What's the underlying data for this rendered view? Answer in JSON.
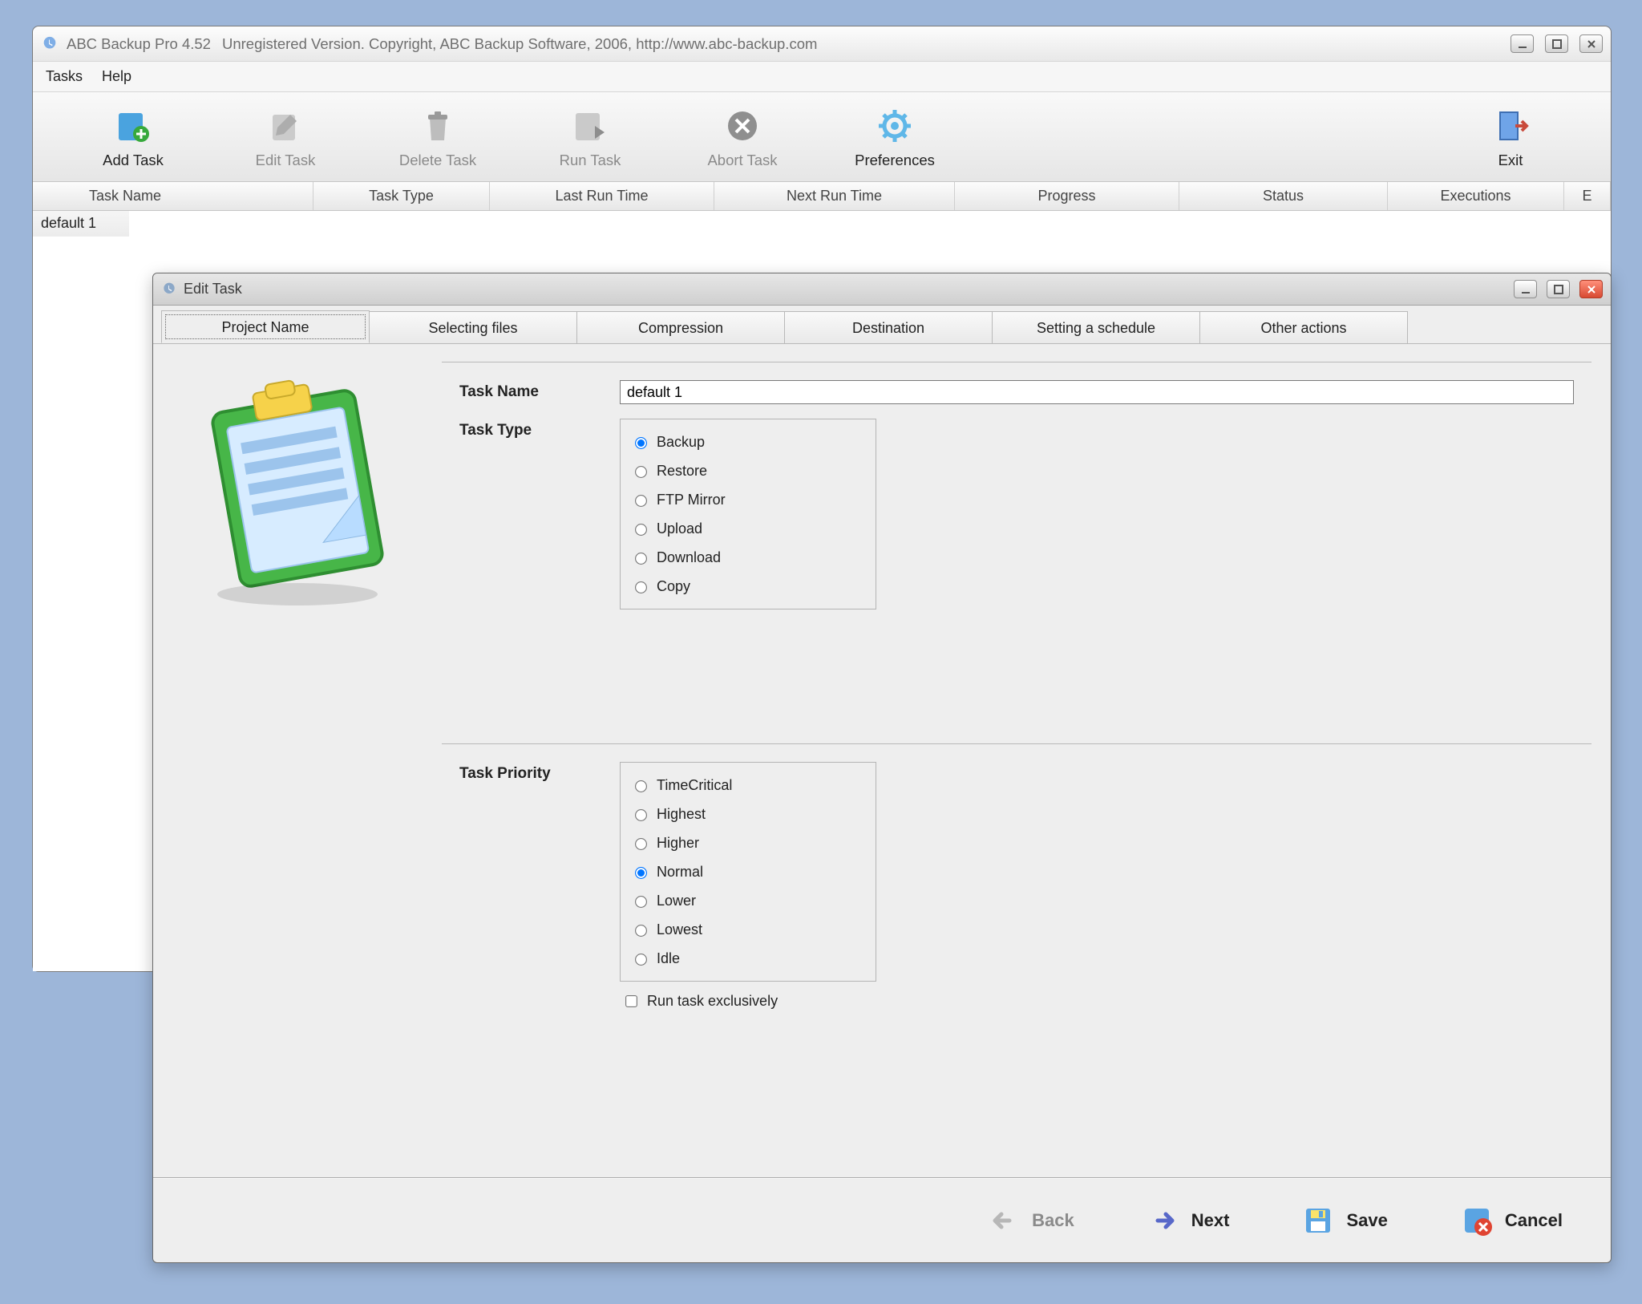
{
  "main_window": {
    "title": "ABC Backup Pro 4.52",
    "subtitle": "Unregistered Version. Copyright, ABC Backup Software, 2006, http://www.abc-backup.com",
    "menubar": {
      "tasks": "Tasks",
      "help": "Help"
    },
    "toolbar": {
      "add_task": "Add Task",
      "edit_task": "Edit Task",
      "delete_task": "Delete Task",
      "run_task": "Run Task",
      "abort_task": "Abort Task",
      "preferences": "Preferences",
      "exit": "Exit"
    },
    "columns": {
      "task_name": "Task Name",
      "task_type": "Task Type",
      "last_run_time": "Last Run Time",
      "next_run_time": "Next Run Time",
      "progress": "Progress",
      "status": "Status",
      "executions": "Executions",
      "overflow": "E"
    },
    "rows": [
      {
        "name": "default 1"
      }
    ]
  },
  "dialog": {
    "title": "Edit Task",
    "tabs": {
      "project_name": "Project Name",
      "selecting_files": "Selecting files",
      "compression": "Compression",
      "destination": "Destination",
      "schedule": "Setting a schedule",
      "other_actions": "Other actions"
    },
    "form": {
      "task_name_label": "Task Name",
      "task_name_value": "default 1",
      "task_type_label": "Task Type",
      "task_type_options": {
        "backup": "Backup",
        "restore": "Restore",
        "ftp_mirror": "FTP Mirror",
        "upload": "Upload",
        "download": "Download",
        "copy": "Copy"
      },
      "task_type_selected": "backup",
      "task_priority_label": "Task Priority",
      "task_priority_options": {
        "time_critical": "TimeCritical",
        "highest": "Highest",
        "higher": "Higher",
        "normal": "Normal",
        "lower": "Lower",
        "lowest": "Lowest",
        "idle": "Idle"
      },
      "task_priority_selected": "normal",
      "run_exclusive_label": "Run task exclusively",
      "run_exclusive_checked": false
    },
    "footer": {
      "back": "Back",
      "next": "Next",
      "save": "Save",
      "cancel": "Cancel"
    }
  }
}
